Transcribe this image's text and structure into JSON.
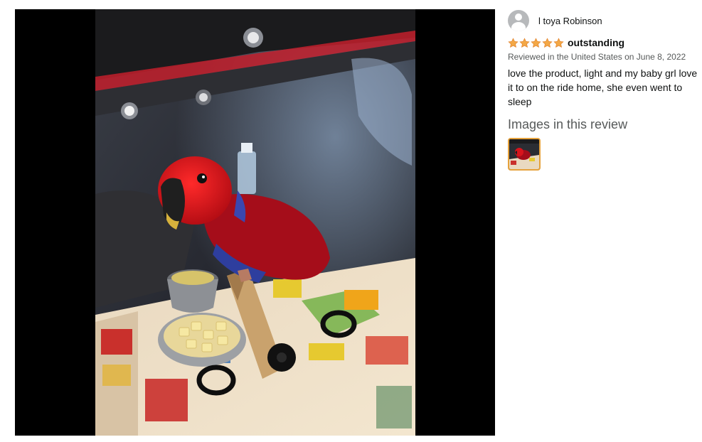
{
  "review": {
    "profile_name": "l toya Robinson",
    "rating": 5,
    "rating_max": 5,
    "title": "outstanding",
    "date": "Reviewed in the United States on June 8, 2022",
    "body": "love the product, light and my baby grl love it to on the ride home, she even went to sleep",
    "images_heading": "Images in this review"
  },
  "colors": {
    "star": "#f3a847",
    "thumb_border": "#e6a23c",
    "viewer_bg": "#000000"
  },
  "icons": {
    "avatar": "default-profile-avatar",
    "star": "star-icon"
  }
}
